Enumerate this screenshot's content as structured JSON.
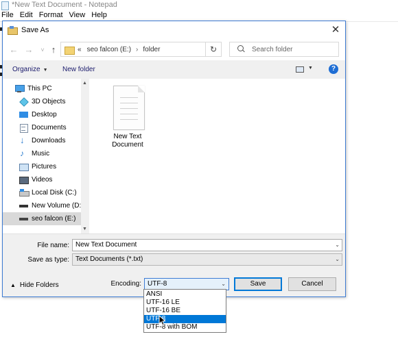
{
  "notepad": {
    "title": "*New Text Document - Notepad",
    "menu": [
      "File",
      "Edit",
      "Format",
      "View",
      "Help"
    ]
  },
  "dialog": {
    "title": "Save As",
    "close_glyph": "✕"
  },
  "nav": {
    "back_glyph": "←",
    "forward_glyph": "→",
    "recent_glyph": "˅",
    "up_glyph": "↑",
    "breadcrumb_prefix": "«",
    "breadcrumb": [
      "seo falcon (E:)",
      "folder"
    ],
    "breadcrumb_sep": "›",
    "refresh_glyph": "↻",
    "search_placeholder": "Search folder"
  },
  "toolbar": {
    "organize_label": "Organize",
    "new_folder_label": "New folder",
    "help_glyph": "?"
  },
  "tree": [
    {
      "label": "This PC",
      "icon": "pc-icon"
    },
    {
      "label": "3D Objects",
      "icon": "3d-objects-icon"
    },
    {
      "label": "Desktop",
      "icon": "desktop-icon"
    },
    {
      "label": "Documents",
      "icon": "documents-icon"
    },
    {
      "label": "Downloads",
      "icon": "downloads-icon"
    },
    {
      "label": "Music",
      "icon": "music-icon"
    },
    {
      "label": "Pictures",
      "icon": "pictures-icon"
    },
    {
      "label": "Videos",
      "icon": "videos-icon"
    },
    {
      "label": "Local Disk (C:)",
      "icon": "drive-icon"
    },
    {
      "label": "New Volume (D:",
      "icon": "drive-icon"
    },
    {
      "label": "seo falcon (E:)",
      "icon": "drive-icon"
    }
  ],
  "files": [
    {
      "label": "New Text Document",
      "icon": "text-file-icon"
    }
  ],
  "form": {
    "file_name_label": "File name:",
    "file_name_value": "New Text Document",
    "save_type_label": "Save as type:",
    "save_type_value": "Text Documents (*.txt)",
    "hide_folders_label": "Hide Folders",
    "encoding_label": "Encoding:",
    "encoding_value": "UTF-8",
    "save_label": "Save",
    "cancel_label": "Cancel"
  },
  "encoding_options": [
    "ANSI",
    "UTF-16 LE",
    "UTF-16 BE",
    "UTF-8",
    "UTF-8 with BOM"
  ],
  "encoding_highlighted": "UTF-8",
  "colors": {
    "accent": "#0078d7",
    "selection_gray": "#d9d9d9"
  }
}
